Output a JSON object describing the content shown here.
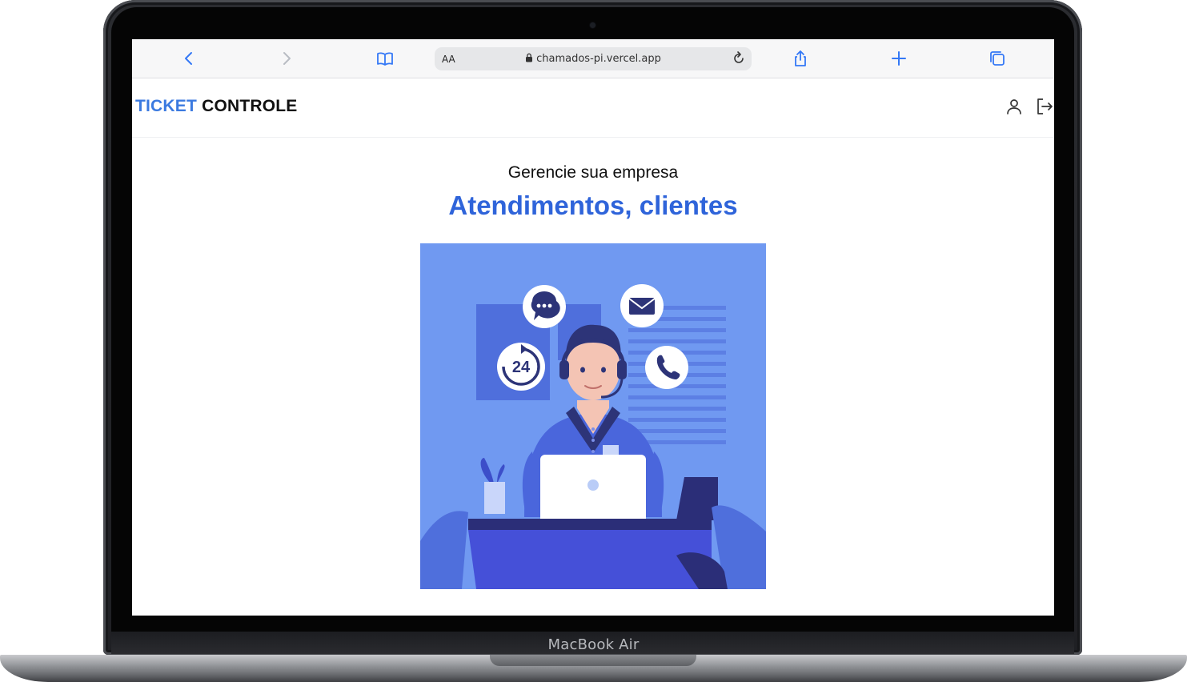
{
  "device": {
    "model_label": "MacBook Air"
  },
  "browser": {
    "text_size_label": "AA",
    "url": "chamados-pi.vercel.app",
    "toolbar_icons": [
      "back-chevron-icon",
      "forward-chevron-icon",
      "bookmarks-book-icon",
      "lock-icon",
      "reload-icon",
      "share-icon",
      "new-tab-plus-icon",
      "tabs-overview-icon"
    ]
  },
  "header": {
    "logo_part1": "TICKET",
    "logo_part2": "CONTROLE",
    "icons": [
      "user-icon",
      "logout-icon"
    ]
  },
  "hero": {
    "subtitle": "Gerencie sua empresa",
    "headline": "Atendimentos, clientes",
    "illustration_badge_text": "24",
    "illustration_icons": [
      "chat-bubble-icon",
      "mail-icon",
      "24h-clock-icon",
      "phone-icon"
    ]
  },
  "colors": {
    "brand_blue": "#3b7ae0",
    "headline_blue": "#2f64da",
    "illustration_bg": "#6f93f0"
  }
}
